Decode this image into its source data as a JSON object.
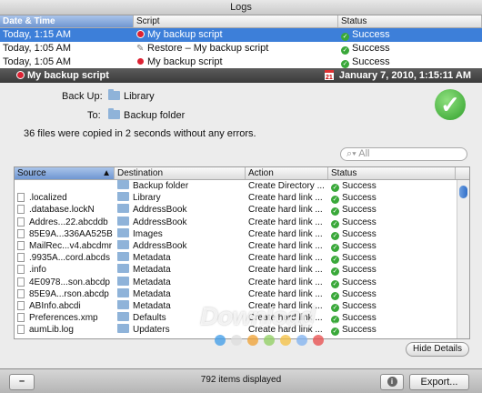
{
  "window": {
    "title": "Logs"
  },
  "logs_table": {
    "headers": [
      "Date & Time",
      "Script",
      "Status"
    ],
    "rows": [
      {
        "date": "Today, 1:15 AM",
        "script": "My backup script",
        "status": "Success",
        "icon": "warning-icon",
        "selected": true
      },
      {
        "date": "Today, 1:05 AM",
        "script": "Restore – My backup script",
        "status": "Success",
        "icon": "brush-icon",
        "selected": false
      },
      {
        "date": "Today, 1:05 AM",
        "script": "My backup script",
        "status": "Success",
        "icon": "warning-icon",
        "selected": false
      }
    ]
  },
  "detail_header": {
    "title": "My backup script",
    "date": "January 7, 2010, 1:15:11 AM"
  },
  "summary": {
    "backup_label": "Back Up:",
    "backup_value": "Library",
    "to_label": "To:",
    "to_value": "Backup folder",
    "result_text": "36 files were copied in 2 seconds without any errors."
  },
  "search": {
    "placeholder": "All"
  },
  "detail_table": {
    "headers": [
      "Source",
      "Destination",
      "Action",
      "Status"
    ],
    "rows": [
      {
        "source": "",
        "destination": "Backup folder",
        "action": "Create Directory ...",
        "status": "Success"
      },
      {
        "source": ".localized",
        "destination": "Library",
        "action": "Create hard link ...",
        "status": "Success"
      },
      {
        "source": ".database.lockN",
        "destination": "AddressBook",
        "action": "Create hard link ...",
        "status": "Success"
      },
      {
        "source": "Addres...22.abcddb",
        "destination": "AddressBook",
        "action": "Create hard link ...",
        "status": "Success"
      },
      {
        "source": "85E9A...336AA525B",
        "destination": "Images",
        "action": "Create hard link ...",
        "status": "Success"
      },
      {
        "source": "MailRec...v4.abcdmr",
        "destination": "AddressBook",
        "action": "Create hard link ...",
        "status": "Success"
      },
      {
        "source": ".9935A...cord.abcds",
        "destination": "Metadata",
        "action": "Create hard link ...",
        "status": "Success"
      },
      {
        "source": ".info",
        "destination": "Metadata",
        "action": "Create hard link ...",
        "status": "Success"
      },
      {
        "source": "4E0978...son.abcdp",
        "destination": "Metadata",
        "action": "Create hard link ...",
        "status": "Success"
      },
      {
        "source": "85E9A...rson.abcdp",
        "destination": "Metadata",
        "action": "Create hard link ...",
        "status": "Success"
      },
      {
        "source": "ABInfo.abcdi",
        "destination": "Metadata",
        "action": "Create hard link ...",
        "status": "Success"
      },
      {
        "source": "Preferences.xmp",
        "destination": "Defaults",
        "action": "Create hard link ...",
        "status": "Success"
      },
      {
        "source": "aumLib.log",
        "destination": "Updaters",
        "action": "Create hard link ...",
        "status": "Success"
      }
    ]
  },
  "buttons": {
    "hide_details": "Hide Details",
    "export": "Export...",
    "minus": "–",
    "info": "i"
  },
  "footer": {
    "count_text": "792 items displayed"
  },
  "watermark": {
    "text": "Download",
    "sub": ".com.vn"
  },
  "colors": {
    "selection": "#3d7fd9",
    "success": "#3aa83a",
    "header_dark": "#3a3a3a"
  }
}
